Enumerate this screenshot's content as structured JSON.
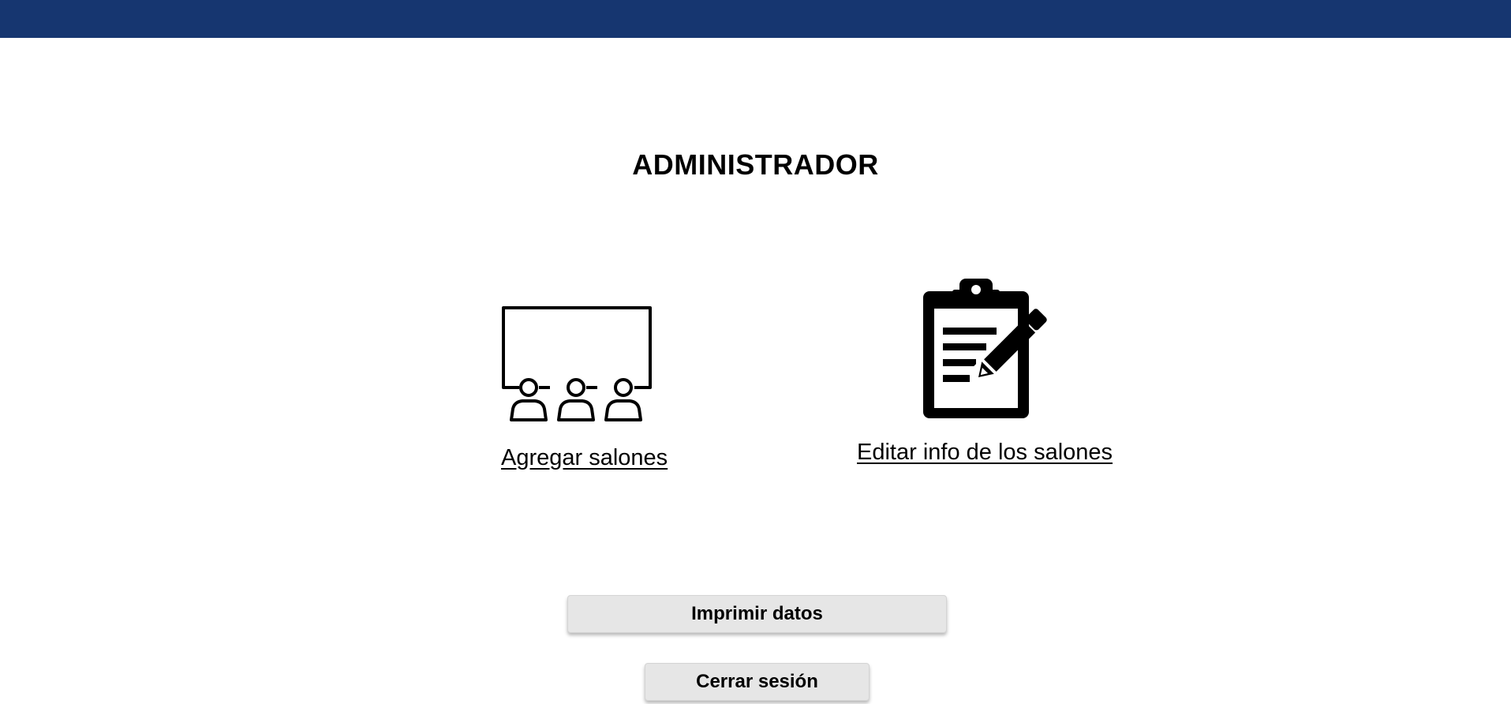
{
  "header": {
    "bar_color": "#163670"
  },
  "page": {
    "title": "ADMINISTRADOR"
  },
  "tiles": [
    {
      "label": "Agregar salones",
      "icon": "classroom-icon"
    },
    {
      "label": "Editar info de los salones",
      "icon": "clipboard-edit-icon"
    }
  ],
  "actions": {
    "print_label": "Imprimir datos",
    "logout_label": "Cerrar sesión"
  },
  "colors": {
    "button_bg": "#e6e6e6",
    "text": "#000000"
  }
}
